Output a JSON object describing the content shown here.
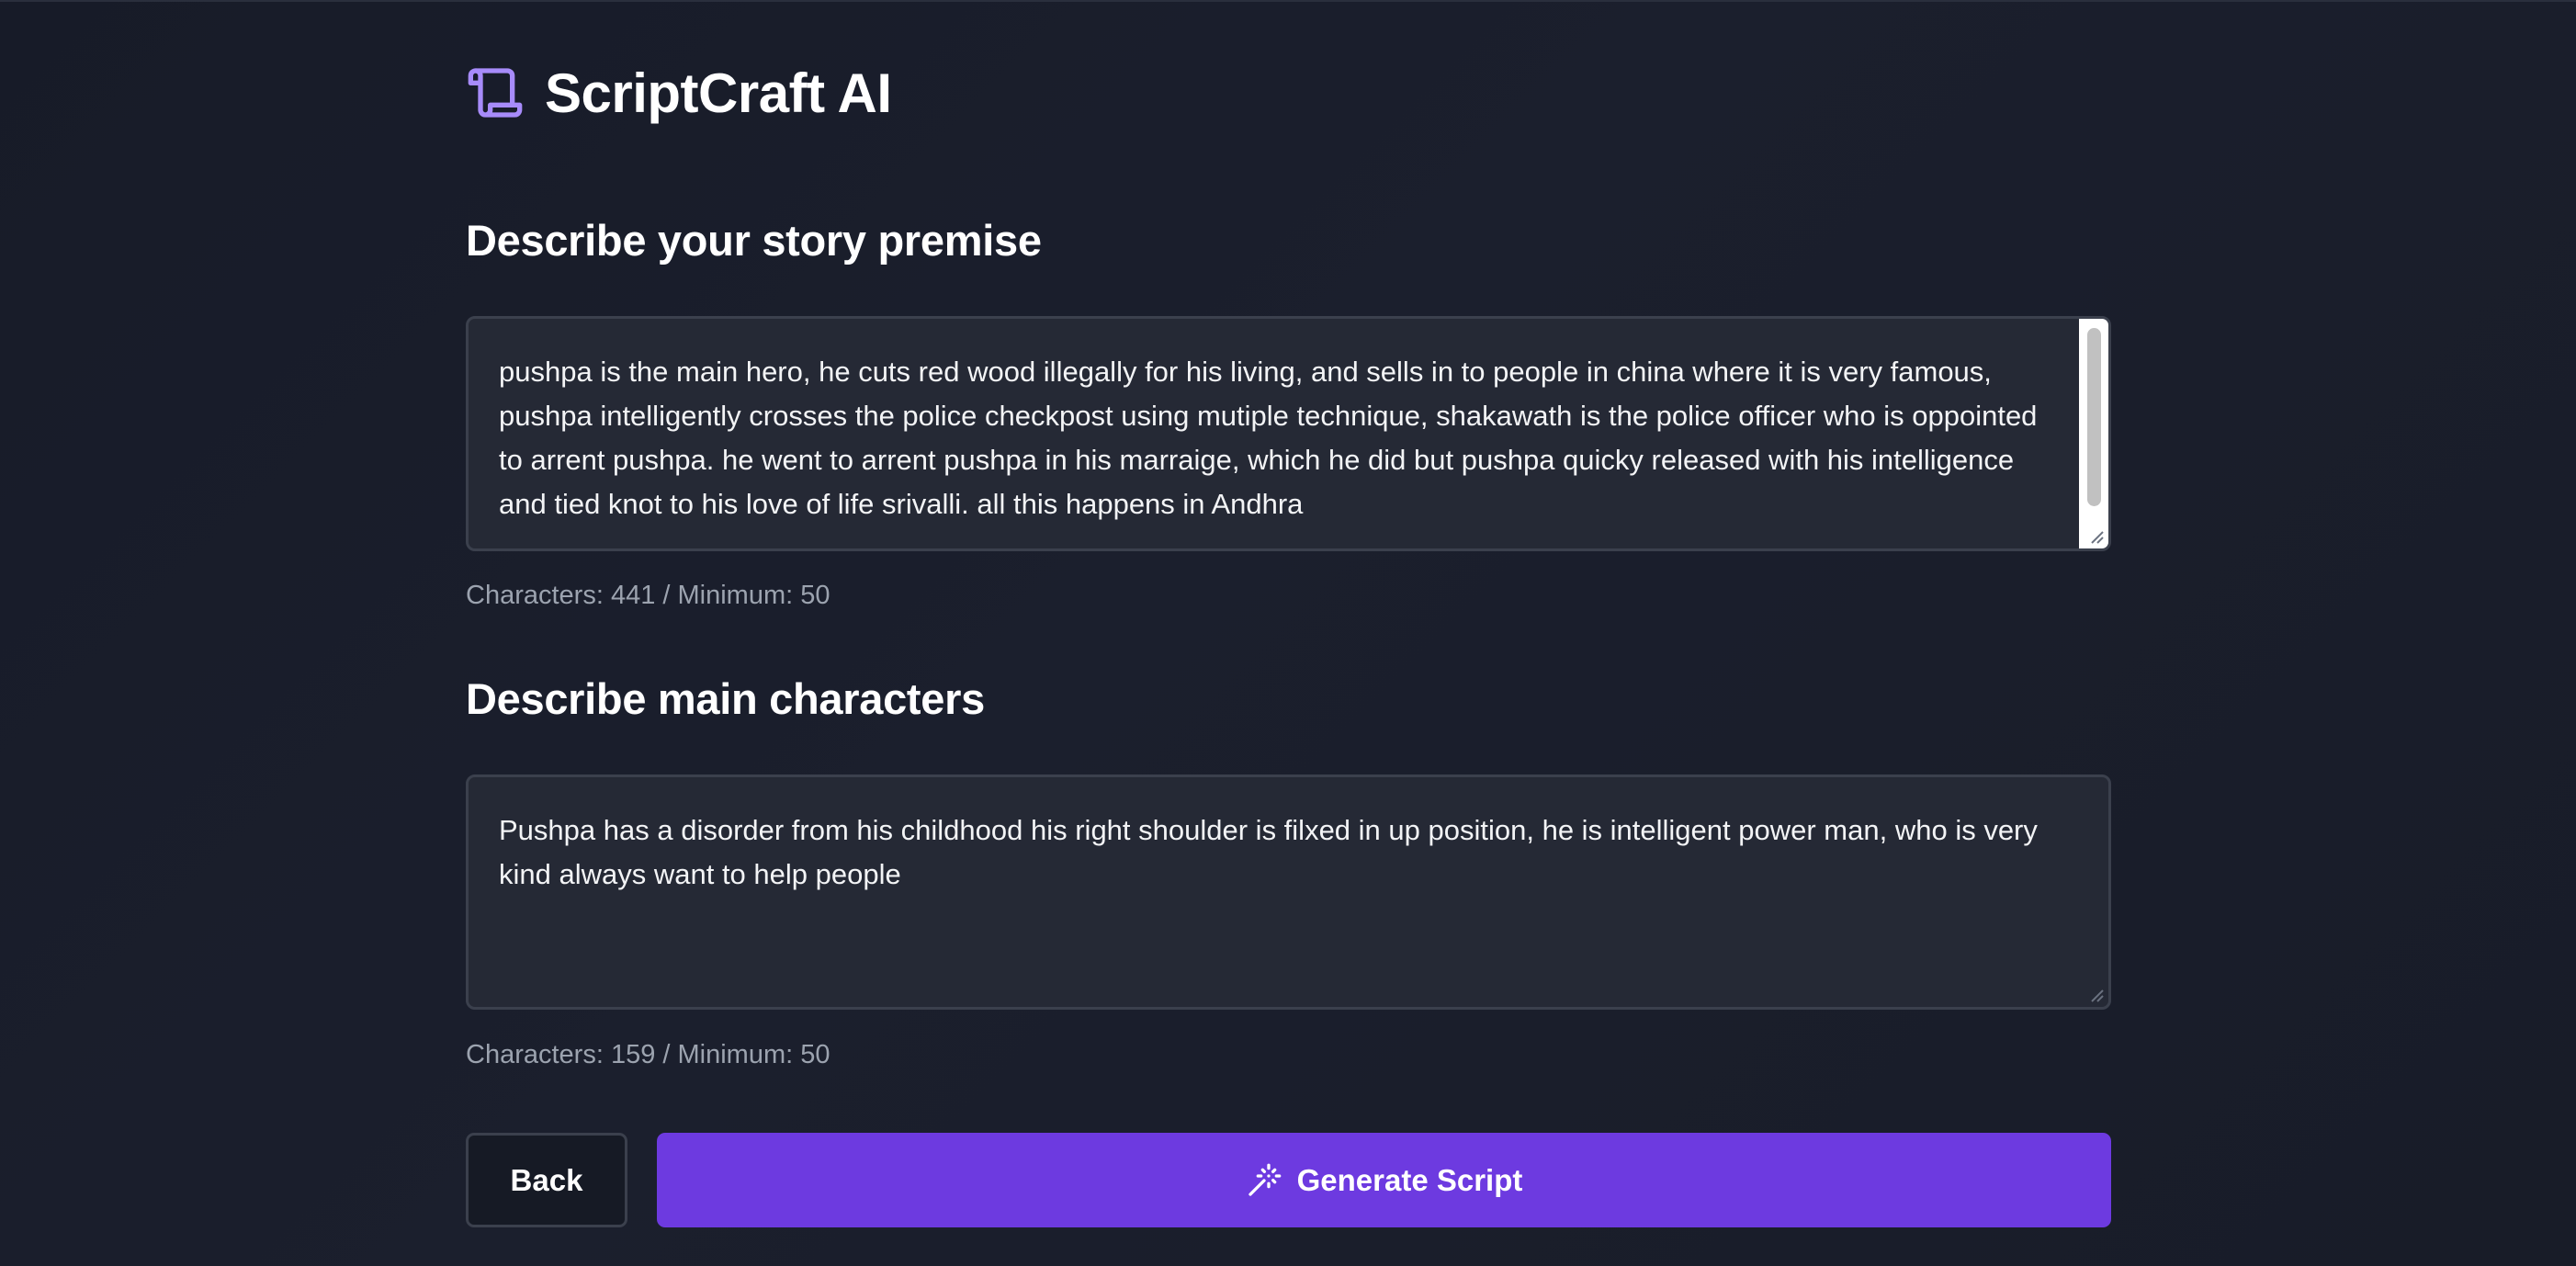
{
  "app": {
    "title": "ScriptCraft AI",
    "logo_icon": "scroll-icon",
    "accent_color": "#a78bfa"
  },
  "premise": {
    "heading": "Describe your story premise",
    "value": "pushpa is the main hero, he cuts red wood illegally for his living, and sells in to people in china where it is very famous, pushpa intelligently crosses the police checkpost using mutiple technique, shakawath is the police officer who is oppointed to arrent pushpa. he went to arrent pushpa in his marraige, which he did but pushpa quicky released with his intelligence and tied knot to his love of life srivalli. all this happens in Andhra",
    "char_count": "Characters: 441 / Minimum: 50"
  },
  "characters": {
    "heading": "Describe main characters",
    "value": "Pushpa has a disorder from his childhood his right shoulder is filxed in up position, he is intelligent power man, who is very kind always want to help people",
    "char_count": "Characters: 159 / Minimum: 50"
  },
  "actions": {
    "back_label": "Back",
    "generate_label": "Generate Script",
    "generate_icon": "magic-wand-icon",
    "generate_color": "#6d3ae0"
  }
}
